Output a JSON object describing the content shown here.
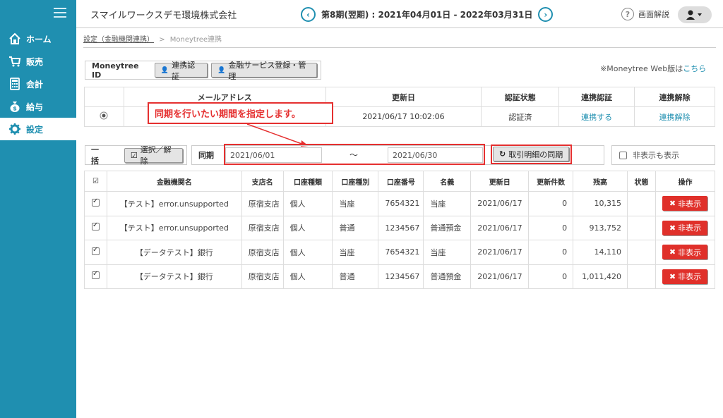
{
  "sidebar": {
    "items": [
      {
        "label": "ホーム",
        "icon": "home-icon"
      },
      {
        "label": "販売",
        "icon": "cart-icon"
      },
      {
        "label": "会計",
        "icon": "calculator-icon"
      },
      {
        "label": "給与",
        "icon": "money-bag-icon"
      },
      {
        "label": "設定",
        "icon": "gear-icon"
      }
    ]
  },
  "header": {
    "company": "スマイルワークスデモ環境株式会社",
    "period": "第8期(翌期) : 2021年04月01日 - 2022年03月31日",
    "help": "画面解説"
  },
  "breadcrumb": {
    "parent": "設定（金融機関連携）",
    "sep": ">",
    "current": "Moneytree連携"
  },
  "moneytree": {
    "label": "Moneytree ID",
    "btn_auth": "連携認証",
    "btn_service": "金融サービス登録・管理",
    "note": "※Moneytree Web版は",
    "note_link": "こちら"
  },
  "account_table": {
    "headers": [
      "",
      "メールアドレス",
      "更新日",
      "認証状態",
      "連携認証",
      "連携解除"
    ],
    "row": {
      "updated": "2021/06/17 10:02:06",
      "status": "認証済",
      "link": "連携する",
      "unlink": "連携解除"
    }
  },
  "callout": "同期を行いたい期間を指定します。",
  "filter": {
    "bulk_label": "一括",
    "select_btn": "選択／解除",
    "period_label": "同期",
    "date_from": "2021/06/01",
    "tilde": "～",
    "date_to": "2021/06/30",
    "sync_btn": "取引明細の同期",
    "show_hidden": "非表示も表示"
  },
  "table": {
    "headers": [
      "金融機関名",
      "支店名",
      "口座種類",
      "口座種別",
      "口座番号",
      "名義",
      "更新日",
      "更新件数",
      "残高",
      "状態",
      "操作"
    ],
    "hide_label": "非表示",
    "rows": [
      {
        "bank": "【テスト】error.unsupported",
        "branch": "原宿支店",
        "kind": "個人",
        "type": "当座",
        "number": "7654321",
        "holder": "当座",
        "updated": "2021/06/17",
        "count": "0",
        "balance": "10,315"
      },
      {
        "bank": "【テスト】error.unsupported",
        "branch": "原宿支店",
        "kind": "個人",
        "type": "普通",
        "number": "1234567",
        "holder": "普通預金",
        "updated": "2021/06/17",
        "count": "0",
        "balance": "913,752"
      },
      {
        "bank": "【データテスト】銀行",
        "branch": "原宿支店",
        "kind": "個人",
        "type": "当座",
        "number": "7654321",
        "holder": "当座",
        "updated": "2021/06/17",
        "count": "0",
        "balance": "14,110"
      },
      {
        "bank": "【データテスト】銀行",
        "branch": "原宿支店",
        "kind": "個人",
        "type": "普通",
        "number": "1234567",
        "holder": "普通預金",
        "updated": "2021/06/17",
        "count": "0",
        "balance": "1,011,420"
      }
    ]
  }
}
